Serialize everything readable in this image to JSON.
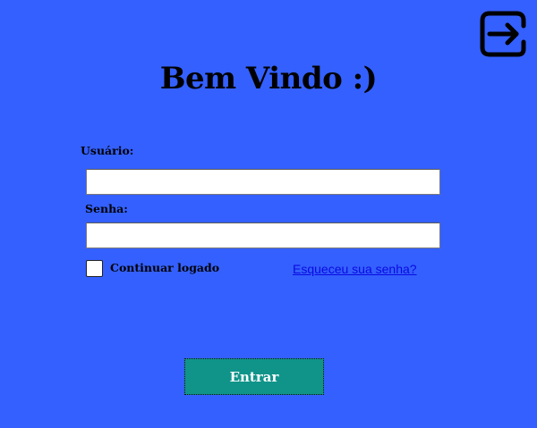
{
  "header": {
    "exit_icon": "exit-icon",
    "title": "Bem Vindo :)"
  },
  "form": {
    "username_label": "Usuário:",
    "username_value": "",
    "password_label": "Senha:",
    "password_value": "",
    "remember_label": "Continuar logado",
    "remember_checked": false,
    "forgot_link": "Esqueceu sua senha?",
    "submit_label": "Entrar"
  },
  "colors": {
    "background": "#3460ff",
    "button": "#10948a",
    "link": "#0a0adf"
  }
}
